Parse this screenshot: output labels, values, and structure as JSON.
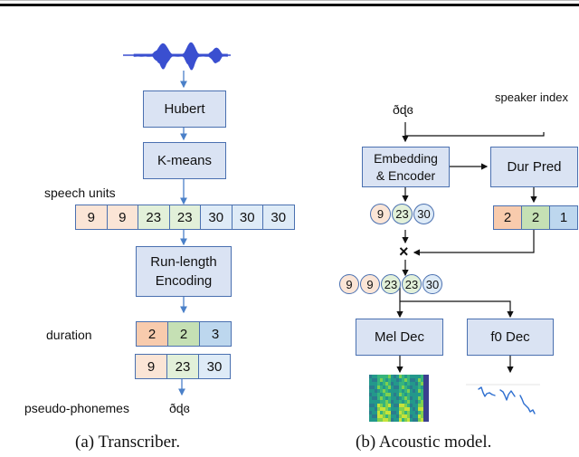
{
  "transcriber": {
    "blocks": {
      "hubert": "Hubert",
      "kmeans": "K-means",
      "rle_line1": "Run-length",
      "rle_line2": "Encoding"
    },
    "labels": {
      "speech_units": "speech units",
      "duration": "duration",
      "pseudo_phonemes": "pseudo-phonemes"
    },
    "speech_units": [
      "9",
      "9",
      "23",
      "23",
      "30",
      "30",
      "30"
    ],
    "durations": [
      "2",
      "2",
      "3"
    ],
    "unique_units": [
      "9",
      "23",
      "30"
    ],
    "pseudo_phoneme_text": "ðɖɞ",
    "caption": "(a) Transcriber."
  },
  "acoustic_model": {
    "input_text": "ðɖɞ",
    "speaker_label": "speaker index",
    "blocks": {
      "encoder_line1": "Embedding",
      "encoder_line2": "& Encoder",
      "dur_pred": "Dur Pred",
      "mel_dec": "Mel Dec",
      "f0_dec": "f0 Dec"
    },
    "encoded_units": [
      "9",
      "23",
      "30"
    ],
    "predicted_durations": [
      "2",
      "2",
      "1"
    ],
    "multiply_symbol": "×",
    "expanded_units": [
      "9",
      "9",
      "23",
      "23",
      "30"
    ],
    "caption": "(b) Acoustic model."
  },
  "colors": {
    "block_fill": "#dae3f3",
    "block_border": "#4a70b0",
    "unit_9": "#fbe5d6",
    "unit_23": "#e2f0d9",
    "unit_30": "#deebf7",
    "dur_9": "#f8cbad",
    "dur_23": "#c5e0b4",
    "dur_30": "#bdd7ee",
    "waveform": "#3a4fd0",
    "f0_curve": "#2e6fd0"
  }
}
